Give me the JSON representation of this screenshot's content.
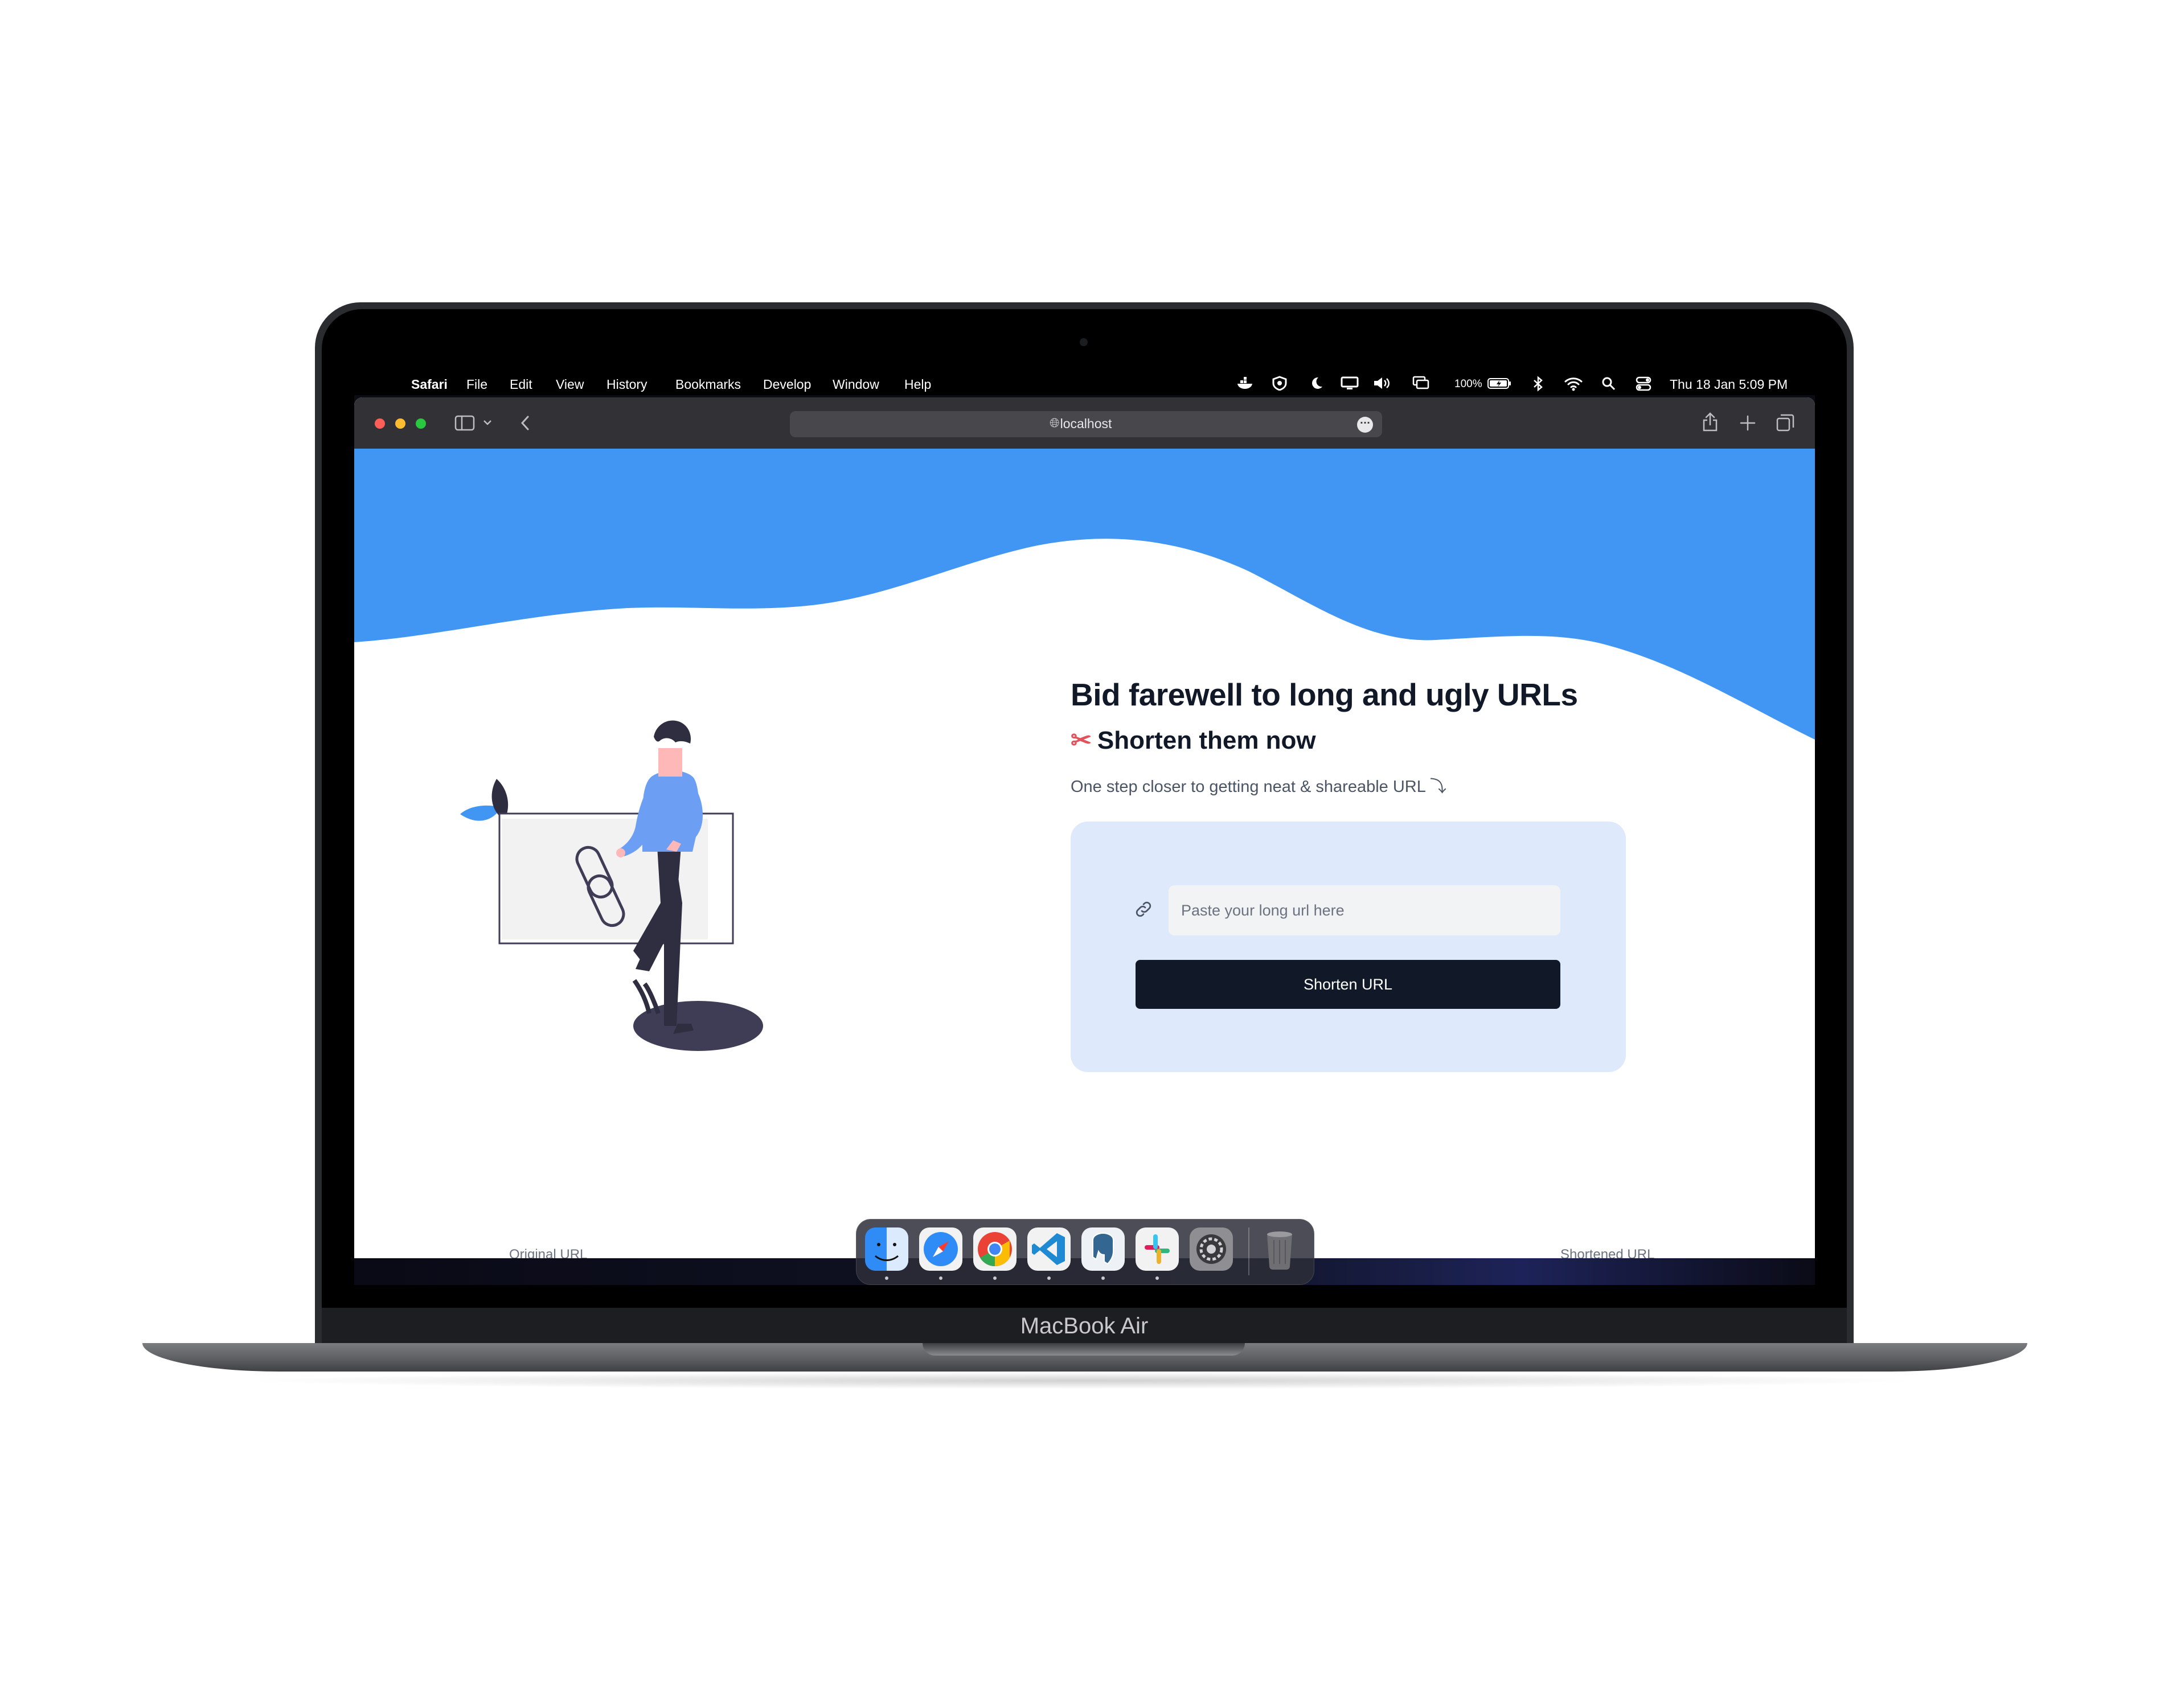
{
  "device": {
    "label": "MacBook Air"
  },
  "menubar": {
    "app_name": "Safari",
    "items": [
      "File",
      "Edit",
      "View",
      "History",
      "Bookmarks",
      "Develop",
      "Window",
      "Help"
    ],
    "battery": "100%",
    "datetime": "Thu 18 Jan  5:09 PM",
    "status_icons": [
      "docker-icon",
      "antivirus-icon",
      "moon-icon",
      "display-icon",
      "volume-icon",
      "screen-mirror-icon",
      "battery-icon",
      "bluetooth-icon",
      "wifi-icon",
      "spotlight-search-icon",
      "control-center-icon"
    ]
  },
  "browser": {
    "address": "localhost",
    "colors": {
      "close": "#ff5f57",
      "minimize": "#febc2e",
      "zoom": "#28c840",
      "toolbar": "#323236"
    }
  },
  "page": {
    "headline": "Bid farewell to long and ugly URLs",
    "subheadline": "Shorten them now",
    "tagline": "One step closer to getting neat & shareable URL ⤵",
    "input_placeholder": "Paste your long url here",
    "button_label": "Shorten URL",
    "footer_left": "Original URL",
    "footer_right": "Shortened URL",
    "colors": {
      "wave": "#4196f4",
      "card": "#deeafc",
      "button": "#111827",
      "text": "#111827"
    }
  },
  "dock": {
    "apps": [
      "Finder",
      "Safari",
      "Google Chrome",
      "Visual Studio Code",
      "pgAdmin",
      "Slack",
      "System Settings"
    ],
    "trash": "Trash"
  }
}
